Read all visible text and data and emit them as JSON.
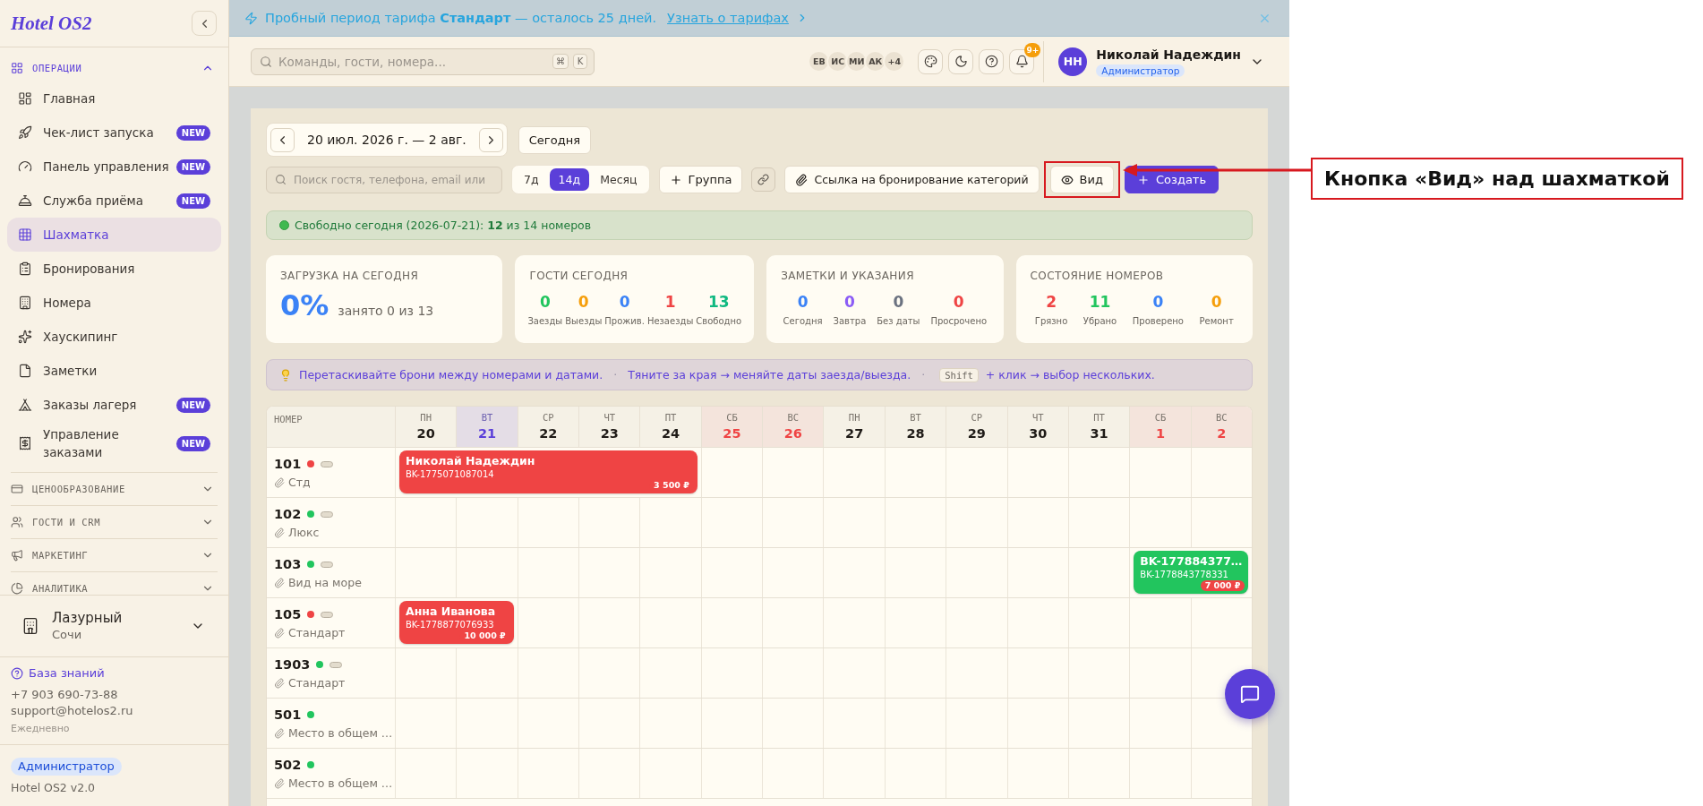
{
  "banner": {
    "message": "Пробный период тарифа **Стандарт** — осталось 25 дней.",
    "link": "Узнать о тарифах"
  },
  "sidebar": {
    "logo": "Hotel OS2",
    "sections": [
      {
        "label": "ОПЕРАЦИИ",
        "expanded": true,
        "items": [
          {
            "label": "Главная",
            "selected": false
          },
          {
            "label": "Чек-лист запуска",
            "badge": "NEW",
            "selected": false
          },
          {
            "label": "Панель управления",
            "badge": "NEW",
            "selected": false
          },
          {
            "label": "Служба приёма",
            "badge": "NEW",
            "selected": false
          },
          {
            "label": "Шахматка",
            "selected": true
          },
          {
            "label": "Бронирования",
            "selected": false
          },
          {
            "label": "Номера",
            "selected": false
          },
          {
            "label": "Хаускипинг",
            "selected": false
          },
          {
            "label": "Заметки",
            "selected": false
          },
          {
            "label": "Заказы лагеря",
            "badge": "NEW",
            "selected": false
          },
          {
            "label": "Управление заказами",
            "badge": "NEW",
            "selected": false
          }
        ]
      },
      {
        "label": "ЦЕНООБРАЗОВАНИЕ",
        "expanded": false
      },
      {
        "label": "ГОСТИ И CRM",
        "expanded": false
      },
      {
        "label": "МАРКЕТИНГ",
        "expanded": false
      },
      {
        "label": "АНАЛИТИКА",
        "expanded": false
      }
    ],
    "hotel": {
      "name": "Лазурный",
      "city": "Сочи"
    },
    "support": {
      "link": "База знаний",
      "phone": "+7 903 690-73-88",
      "email": "support@hotelos2.ru",
      "hours": "Ежедневно"
    },
    "role": "Администратор",
    "version": "Hotel OS2 v2.0"
  },
  "header": {
    "search": {
      "placeholder": "Команды, гости, номера...",
      "keys": [
        "⌘",
        "K"
      ]
    },
    "team": [
      "ЕВ",
      "ИС",
      "МИ",
      "АК",
      "+4"
    ],
    "notifications": "9+",
    "user": {
      "initials": "НН",
      "name": "Николай Надеждин",
      "role": "Администратор"
    }
  },
  "toolbar": {
    "date_range": "20 июл. 2026 г. — 2 авг.",
    "today": "Сегодня",
    "search": {
      "placeholder": "Поиск гостя, телефона, email или"
    },
    "periods": [
      {
        "label": "7д",
        "selected": false
      },
      {
        "label": "14д",
        "selected": true
      },
      {
        "label": "Месяц",
        "selected": false
      }
    ],
    "group": "Группа",
    "category_link": "Ссылка на бронирование категорий",
    "view": "Вид",
    "create": "Создать"
  },
  "free_rooms": {
    "message": "Свободно сегодня (2026-07-21): **12** из 14 номеров"
  },
  "stats": [
    {
      "kind": "percent",
      "title": "ЗАГРУЗКА НА СЕГОДНЯ",
      "value": "0%",
      "caption": "занято 0 из 13"
    },
    {
      "kind": "counters",
      "title": "ГОСТИ СЕГОДНЯ",
      "counters": [
        {
          "value": "0",
          "label": "Заезды",
          "color": "#22c55e"
        },
        {
          "value": "0",
          "label": "Выезды",
          "color": "#f59e0b"
        },
        {
          "value": "0",
          "label": "Прожив.",
          "color": "#3b82f6"
        },
        {
          "value": "1",
          "label": "Незаезды",
          "color": "#ef4444"
        },
        {
          "value": "13",
          "label": "Свободно",
          "color": "#10b981"
        }
      ]
    },
    {
      "kind": "counters",
      "title": "ЗАМЕТКИ И УКАЗАНИЯ",
      "counters": [
        {
          "value": "0",
          "label": "Сегодня",
          "color": "#3b82f6"
        },
        {
          "value": "0",
          "label": "Завтра",
          "color": "#8b5cf6"
        },
        {
          "value": "0",
          "label": "Без даты",
          "color": "#6b7280"
        },
        {
          "value": "0",
          "label": "Просрочено",
          "color": "#ef4444"
        }
      ]
    },
    {
      "kind": "counters",
      "title": "СОСТОЯНИЕ НОМЕРОВ",
      "counters": [
        {
          "value": "2",
          "label": "Грязно",
          "color": "#ef4444"
        },
        {
          "value": "11",
          "label": "Убрано",
          "color": "#22c55e"
        },
        {
          "value": "0",
          "label": "Проверено",
          "color": "#3b82f6"
        },
        {
          "value": "0",
          "label": "Ремонт",
          "color": "#f59e0b"
        }
      ]
    }
  ],
  "hints": {
    "items": [
      {
        "kind": "tip",
        "text": "Перетаскивайте брони между номерами и датами."
      },
      {
        "kind": "separator",
        "text": "·"
      },
      {
        "kind": "tip",
        "text": "Тяните за края → меняйте даты заезда/выезда."
      },
      {
        "kind": "separator",
        "text": "·"
      },
      {
        "kind": "shortcut",
        "key": "Shift",
        "text": "+ клик → выбор нескольких."
      }
    ]
  },
  "grid": {
    "room_header": "НОМЕР",
    "days": [
      {
        "weekday": "ПН",
        "day": "20",
        "weekend": false,
        "today": false
      },
      {
        "weekday": "ВТ",
        "day": "21",
        "weekend": false,
        "today": true
      },
      {
        "weekday": "СР",
        "day": "22",
        "weekend": false,
        "today": false
      },
      {
        "weekday": "ЧТ",
        "day": "23",
        "weekend": false,
        "today": false
      },
      {
        "weekday": "ПТ",
        "day": "24",
        "weekend": false,
        "today": false
      },
      {
        "weekday": "СБ",
        "day": "25",
        "weekend": true,
        "today": false
      },
      {
        "weekday": "ВС",
        "day": "26",
        "weekend": true,
        "today": false
      },
      {
        "weekday": "ПН",
        "day": "27",
        "weekend": false,
        "today": false
      },
      {
        "weekday": "ВТ",
        "day": "28",
        "weekend": false,
        "today": false
      },
      {
        "weekday": "СР",
        "day": "29",
        "weekend": false,
        "today": false
      },
      {
        "weekday": "ЧТ",
        "day": "30",
        "weekend": false,
        "today": false
      },
      {
        "weekday": "ПТ",
        "day": "31",
        "weekend": false,
        "today": false
      },
      {
        "weekday": "СБ",
        "day": "1",
        "weekend": true,
        "today": false
      },
      {
        "weekday": "ВС",
        "day": "2",
        "weekend": true,
        "today": false
      }
    ],
    "rooms": [
      {
        "number": "101",
        "color": "#ef4444",
        "pill_marker": true,
        "type": "Стд",
        "timeline": [
          {
            "kind": "booking",
            "guest": "Николай Надеждин",
            "code": "BK-1775071087014",
            "price": "3 500 ₽",
            "color": "#ef4444"
          },
          {
            "kind": "continued"
          },
          {
            "kind": "continued"
          },
          {
            "kind": "continued"
          },
          {
            "kind": "continued"
          },
          {
            "kind": "empty"
          },
          {
            "kind": "empty"
          },
          {
            "kind": "empty"
          },
          {
            "kind": "empty"
          },
          {
            "kind": "empty"
          },
          {
            "kind": "empty"
          },
          {
            "kind": "empty"
          },
          {
            "kind": "empty"
          },
          {
            "kind": "empty"
          }
        ]
      },
      {
        "number": "102",
        "color": "#22c55e",
        "pill_marker": true,
        "type": "Люкс",
        "timeline": [
          {
            "kind": "empty"
          },
          {
            "kind": "empty"
          },
          {
            "kind": "empty"
          },
          {
            "kind": "empty"
          },
          {
            "kind": "empty"
          },
          {
            "kind": "empty"
          },
          {
            "kind": "empty"
          },
          {
            "kind": "empty"
          },
          {
            "kind": "empty"
          },
          {
            "kind": "empty"
          },
          {
            "kind": "empty"
          },
          {
            "kind": "empty"
          },
          {
            "kind": "empty"
          },
          {
            "kind": "empty"
          }
        ]
      },
      {
        "number": "103",
        "color": "#22c55e",
        "pill_marker": true,
        "type": "Вид на море",
        "timeline": [
          {
            "kind": "empty"
          },
          {
            "kind": "empty"
          },
          {
            "kind": "empty"
          },
          {
            "kind": "empty"
          },
          {
            "kind": "empty"
          },
          {
            "kind": "empty"
          },
          {
            "kind": "empty"
          },
          {
            "kind": "empty"
          },
          {
            "kind": "empty"
          },
          {
            "kind": "empty"
          },
          {
            "kind": "empty"
          },
          {
            "kind": "empty"
          },
          {
            "kind": "booking",
            "guest": "BK-177884377…",
            "code": "BK-1778843778331",
            "price": "7 000 ₽",
            "color": "#22c55e"
          },
          {
            "kind": "continued"
          }
        ]
      },
      {
        "number": "105",
        "color": "#ef4444",
        "pill_marker": true,
        "type": "Стандарт",
        "timeline": [
          {
            "kind": "booking",
            "guest": "Анна Иванова",
            "code": "BK-1778877076933",
            "price": "10 000 ₽",
            "color": "#ef4444"
          },
          {
            "kind": "continued"
          },
          {
            "kind": "empty"
          },
          {
            "kind": "empty"
          },
          {
            "kind": "empty"
          },
          {
            "kind": "empty"
          },
          {
            "kind": "empty"
          },
          {
            "kind": "empty"
          },
          {
            "kind": "empty"
          },
          {
            "kind": "empty"
          },
          {
            "kind": "empty"
          },
          {
            "kind": "empty"
          },
          {
            "kind": "empty"
          },
          {
            "kind": "empty"
          }
        ]
      },
      {
        "number": "1903",
        "color": "#22c55e",
        "pill_marker": true,
        "type": "Стандарт",
        "timeline": [
          {
            "kind": "empty"
          },
          {
            "kind": "empty"
          },
          {
            "kind": "empty"
          },
          {
            "kind": "empty"
          },
          {
            "kind": "empty"
          },
          {
            "kind": "empty"
          },
          {
            "kind": "empty"
          },
          {
            "kind": "empty"
          },
          {
            "kind": "empty"
          },
          {
            "kind": "empty"
          },
          {
            "kind": "empty"
          },
          {
            "kind": "empty"
          },
          {
            "kind": "empty"
          },
          {
            "kind": "empty"
          }
        ]
      },
      {
        "number": "501",
        "color": "#22c55e",
        "pill_marker": false,
        "type": "Место в общем …",
        "timeline": [
          {
            "kind": "empty"
          },
          {
            "kind": "empty"
          },
          {
            "kind": "empty"
          },
          {
            "kind": "empty"
          },
          {
            "kind": "empty"
          },
          {
            "kind": "empty"
          },
          {
            "kind": "empty"
          },
          {
            "kind": "empty"
          },
          {
            "kind": "empty"
          },
          {
            "kind": "empty"
          },
          {
            "kind": "empty"
          },
          {
            "kind": "empty"
          },
          {
            "kind": "empty"
          },
          {
            "kind": "empty"
          }
        ]
      },
      {
        "number": "502",
        "color": "#22c55e",
        "pill_marker": false,
        "type": "Место в общем …",
        "timeline": [
          {
            "kind": "empty"
          },
          {
            "kind": "empty"
          },
          {
            "kind": "empty"
          },
          {
            "kind": "empty"
          },
          {
            "kind": "empty"
          },
          {
            "kind": "empty"
          },
          {
            "kind": "empty"
          },
          {
            "kind": "empty"
          },
          {
            "kind": "empty"
          },
          {
            "kind": "empty"
          },
          {
            "kind": "empty"
          },
          {
            "kind": "empty"
          },
          {
            "kind": "empty"
          },
          {
            "kind": "empty"
          }
        ]
      }
    ]
  },
  "annotation": {
    "label": "Кнопка «Вид» над шахматкой"
  }
}
